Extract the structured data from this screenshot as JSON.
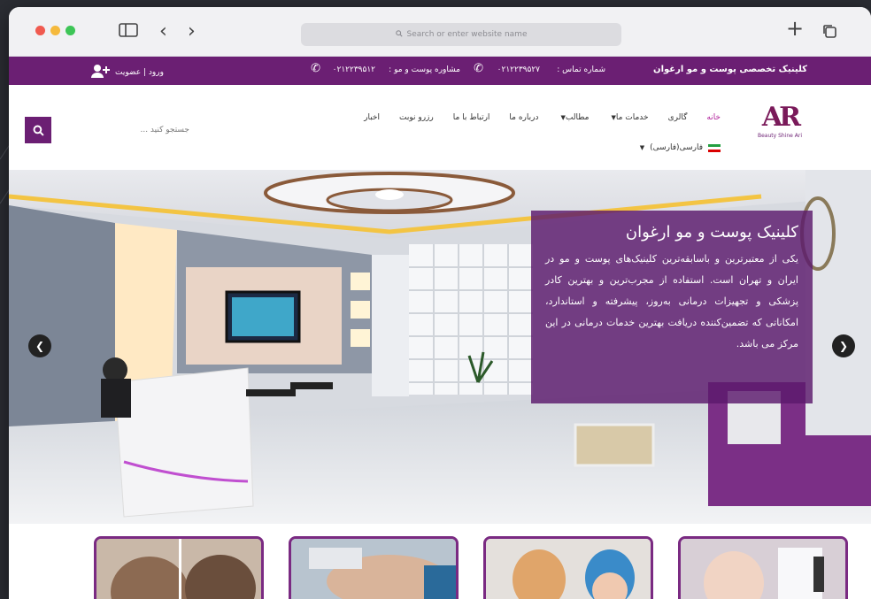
{
  "browser": {
    "address_placeholder": "Search or enter website name",
    "new_tab": "+",
    "back": "‹",
    "forward": "›"
  },
  "topbar": {
    "brand": "کلینیک تخصصی پوست و مو ارغوان",
    "contact_label": "شماره تماس :",
    "phone1": "۰۲۱۲۲۳۹۵۲۷",
    "consult_label": "مشاوره پوست و مو :",
    "phone2": "۰۲۱۲۲۳۹۵۱۲",
    "login": "ورود | عضویت"
  },
  "header": {
    "logo_mark": "AR",
    "logo_name": "Beauty Shine Ari",
    "nav": [
      "خانه",
      "گالری",
      "خدمات ما",
      "مطالب",
      "درباره ما",
      "ارتباط با ما",
      "رزرو نوبت",
      "اخبار"
    ],
    "lang": "فارسی(فارسی)",
    "search_placeholder": "جستجو کنید ..."
  },
  "hero": {
    "title": "کلینیک پوست و مو ارغوان",
    "body": "یکی از معتبرترین و باسابقه‌ترین کلینیک‌های پوست و مو در ایران و تهران است. استفاده از مجرب‌ترین و بهترین کادر پزشکی و تجهیزات درمانی به‌روز، پیشرفته و استاندارد، امکاناتی که تضمین‌کننده دریافت بهترین خدمات درمانی در این مرکز می باشد."
  },
  "colors": {
    "brand_purple": "#6b1f73",
    "accent_pink": "#b0209a"
  }
}
